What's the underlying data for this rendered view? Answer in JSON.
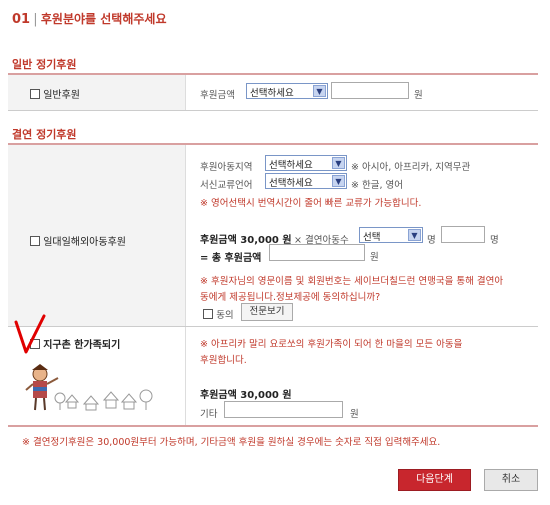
{
  "header": {
    "step_num": "01",
    "divider": "|",
    "title": "후원분야를 선택해주세요"
  },
  "general": {
    "section_title": "일반 정기후원",
    "item_label": "일반후원",
    "amount_label": "후원금액",
    "amount_select": "선택하세요",
    "unit": "원"
  },
  "kinship": {
    "section_title": "결연 정기후원",
    "item_label": "일대일해외아동후원",
    "region_label": "후원아동지역",
    "region_select": "선택하세요",
    "region_note": "※ 아시아, 아프리카, 지역무관",
    "lang_label": "서신교류언어",
    "lang_select": "선택하세요",
    "lang_note": "※ 한글, 영어",
    "lang_warning": "※ 영어선택시 번역시간이 줄어 빠른 교류가 가능합니다.",
    "amount_prefix": "후원금액 30,000 원",
    "times_label": "× 결연아동수",
    "count_select": "선택",
    "count_unit1": "명",
    "count_unit2": "명",
    "total_label": "= 총 후원금액",
    "unit": "원",
    "consent_text_1": "※ 후원자님의 영문이름 및 회원번호는 세이브더칠드런 연맹국을 통해 결연아",
    "consent_text_2": "동에게 제공됩니다.정보제공에 동의하십니까?",
    "agree_label": "동의",
    "full_text_button": "전문보기"
  },
  "village": {
    "item_label": "지구촌 한가족되기",
    "desc_1": "※ 아프리카 말리 요로쏘의 후원가족이 되어 한 마을의 모든 아동을",
    "desc_2": "후원합니다.",
    "amount_label": "후원금액 30,000 원",
    "other_label": "기타",
    "unit": "원"
  },
  "footer": {
    "notice": "※ 결연정기후원은 30,000원부터 가능하며, 기타금액 후원을 원하실 경우에는 숫자로 직접 입력해주세요.",
    "next_button": "다음단계",
    "cancel_button": "취소"
  }
}
